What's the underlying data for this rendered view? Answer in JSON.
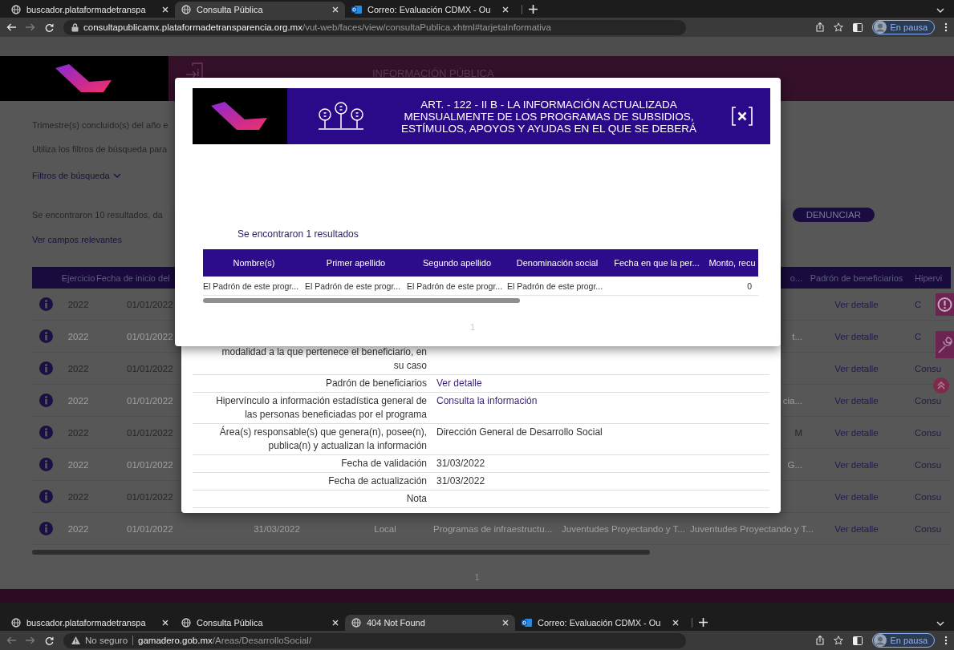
{
  "browser_windows": [
    {
      "tabs": [
        {
          "title": "buscador.plataformadetranspa",
          "kind": "globe",
          "selected": false
        },
        {
          "title": "Consulta Pública",
          "kind": "globe",
          "selected": true
        },
        {
          "title": "Correo: Evaluación CDMX - Ou",
          "kind": "mail",
          "selected": false
        }
      ],
      "nav": {
        "back_disabled": false,
        "forward_disabled": true
      },
      "address": {
        "security": {
          "kind": "secure"
        },
        "host": "consultapublicamx.plataformadetransparencia.org.mx",
        "path": "/vut-web/faces/view/consultaPublica.xhtml#tarjetaInformativa"
      },
      "profile": "En pausa"
    },
    {
      "tabs": [
        {
          "title": "buscador.plataformadetranspa",
          "kind": "globe",
          "selected": false
        },
        {
          "title": "Consulta Pública",
          "kind": "globe",
          "selected": false
        },
        {
          "title": "404 Not Found",
          "kind": "globe",
          "selected": true
        },
        {
          "title": "Correo: Evaluación CDMX - Ou",
          "kind": "mail",
          "selected": false
        }
      ],
      "nav": {
        "back_disabled": true,
        "forward_disabled": true
      },
      "address": {
        "security": {
          "kind": "warning",
          "label": "No seguro"
        },
        "host": "gamadero.gob.mx",
        "path": "/Areas/DesarrolloSocial/"
      },
      "profile": "En pausa"
    }
  ],
  "page": {
    "header": {
      "title": "INFORMACIÓN PÚBLICA"
    },
    "intro": [
      "Trimestre(s) concluido(s) del año e",
      "Utiliza los filtros de búsqueda para"
    ],
    "filters_toggle": "Filtros de búsqueda",
    "results_text": "Se encontraron 10 resultados, da",
    "report_button": "DENUNCIAR",
    "relevant_fields_link": "Ver campos relevantes",
    "table": {
      "columns": [
        "Ejercicio",
        "Fecha de inicio del",
        "o...",
        "Padrón de beneficiarios",
        "Hipervi"
      ],
      "rows": [
        {
          "ejercicio": "2022",
          "fecha_inicio": "01/01/2022",
          "padron": "Ver detalle",
          "hipervinculo": "C"
        },
        {
          "ejercicio": "2022",
          "fecha_inicio": "01/01/2022",
          "column_7": "t...",
          "padron": "Ver detalle",
          "hipervinculo": "C"
        },
        {
          "ejercicio": "2022",
          "fecha_inicio": "01/01/2022",
          "padron": "Ver detalle",
          "hipervinculo": "Consu"
        },
        {
          "ejercicio": "2022",
          "fecha_inicio": "01/01/2022",
          "column_7": "cia...",
          "padron": "Ver detalle",
          "hipervinculo": "Consu"
        },
        {
          "ejercicio": "2022",
          "fecha_inicio": "01/01/2022",
          "column_7": "M",
          "padron": "Ver detalle",
          "hipervinculo": "Consu"
        },
        {
          "ejercicio": "2022",
          "fecha_inicio": "01/01/2022",
          "column_7": "G...",
          "padron": "Ver detalle",
          "hipervinculo": "Consu"
        },
        {
          "ejercicio": "2022",
          "fecha_inicio": "01/01/2022",
          "padron": "Ver detalle",
          "hipervinculo": "Consu"
        },
        {
          "ejercicio": "2022",
          "fecha_inicio": "01/01/2022",
          "fecha_termino": "31/03/2022",
          "ambito": "Local",
          "column_5": "Programas de infraestructu...",
          "column_6": "Juventudes Proyectando y T...",
          "column_7": "Juventudes Proyectando y T...",
          "padron": "Ver detalle",
          "hipervinculo": "Consu"
        }
      ]
    },
    "pagination": [
      "1"
    ]
  },
  "detail_modal": {
    "rows": [
      {
        "label": "modalidad a la que pertenece el beneficiario, en su caso",
        "kind": "text"
      },
      {
        "label": "Padrón de beneficiarios",
        "value": "Ver detalle",
        "kind": "link"
      },
      {
        "label": "Hipervínculo a información estadística general de las personas beneficiadas por el programa",
        "value": "Consulta la información",
        "kind": "link"
      },
      {
        "label": "Área(s) responsable(s) que genera(n), posee(n), publica(n) y actualizan la información",
        "value": "Dirección General de Desarrollo Social",
        "kind": "text"
      },
      {
        "label": "Fecha de validación",
        "value": "31/03/2022",
        "kind": "text"
      },
      {
        "label": "Fecha de actualización",
        "value": "31/03/2022",
        "kind": "text"
      },
      {
        "label": "Nota",
        "kind": "text"
      }
    ]
  },
  "summary_modal": {
    "title": "ART. - 122 - II B - LA INFORMACIÓN ACTUALIZADA MENSUALMENTE DE LOS PROGRAMAS DE SUBSIDIOS, ESTÍMULOS, APOYOS Y AYUDAS EN EL QUE SE DEBERÁ",
    "results_text": "Se encontraron 1 resultados",
    "columns": [
      "Nombre(s)",
      "Primer apellido",
      "Segundo apellido",
      "Denominación social",
      "Fecha en que la per...",
      "Monto, recu"
    ],
    "rows": [
      {
        "nombres": "El Padrón de este progr...",
        "primer_apellido": "El Padrón de este progr...",
        "segundo_apellido": "El Padrón de este progr...",
        "denominacion_social": "El Padrón de este progr...",
        "monto": "0"
      }
    ],
    "pagination": [
      "1"
    ]
  }
}
